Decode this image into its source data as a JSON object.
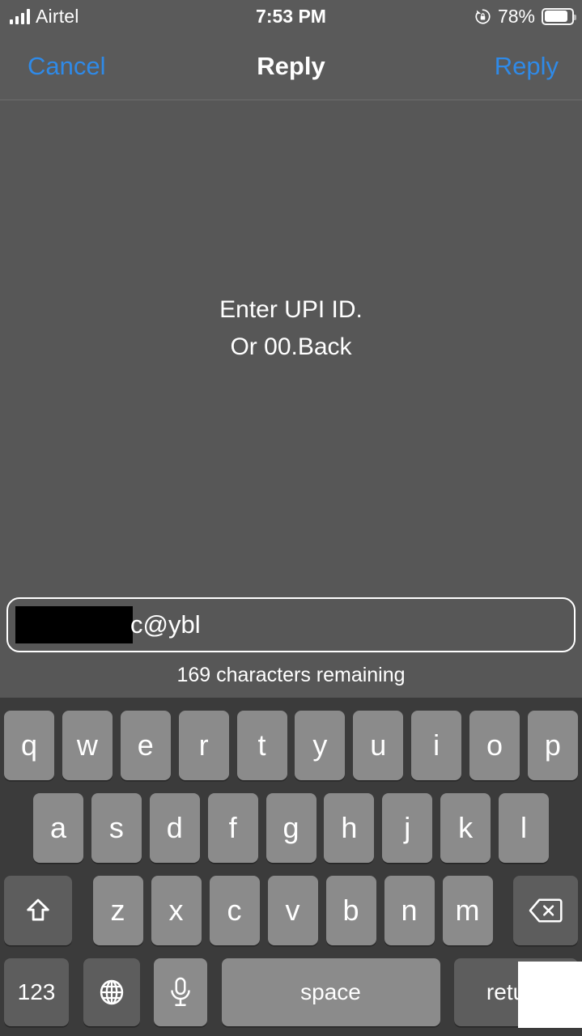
{
  "status_bar": {
    "carrier": "Airtel",
    "signal_bars": 4,
    "time": "7:53 PM",
    "battery_percent": "78%",
    "battery_level": 78,
    "rotation_lock_icon": "rotation-lock-icon",
    "battery_icon": "battery-icon"
  },
  "nav_bar": {
    "cancel_label": "Cancel",
    "title": "Reply",
    "reply_label": "Reply",
    "accent_color": "#2f8ae8"
  },
  "content": {
    "prompt_line_1": "Enter UPI ID.",
    "prompt_line_2": "Or 00.Back"
  },
  "compose": {
    "text_visible": "c@ybl",
    "redacted": true,
    "placeholder": "",
    "counter": "169 characters remaining"
  },
  "keyboard": {
    "row1": [
      "q",
      "w",
      "e",
      "r",
      "t",
      "y",
      "u",
      "i",
      "o",
      "p"
    ],
    "row2": [
      "a",
      "s",
      "d",
      "f",
      "g",
      "h",
      "j",
      "k",
      "l"
    ],
    "row3_letters": [
      "z",
      "x",
      "c",
      "v",
      "b",
      "n",
      "m"
    ],
    "shift_icon": "shift-icon",
    "backspace_icon": "backspace-icon",
    "numbers_label": "123",
    "globe_icon": "globe-icon",
    "microphone_icon": "microphone-icon",
    "space_label": "space",
    "return_label": "return"
  },
  "colors": {
    "screen_bg": "#575757",
    "bar_bg": "#5a5a5a",
    "keyboard_bg": "#3b3b3b",
    "key_bg": "#8b8b8b",
    "key_mod_bg": "#5d5d5d",
    "accent_blue": "#2f8ae8",
    "text_white": "#ffffff"
  }
}
